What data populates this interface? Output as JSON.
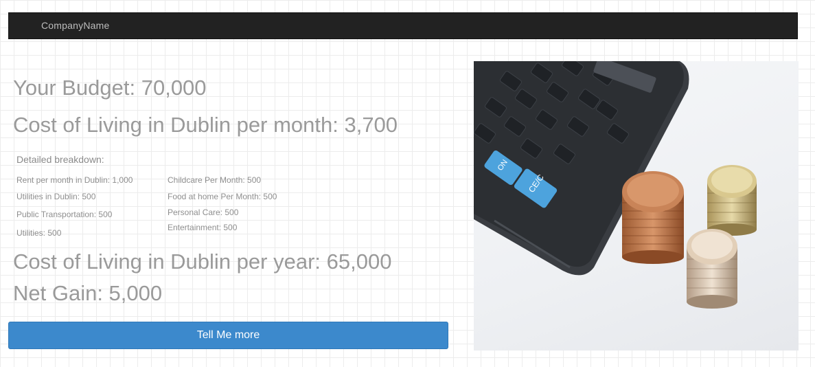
{
  "navbar": {
    "brand": "CompanyName"
  },
  "budget": {
    "your_budget": "Your Budget: 70,000",
    "cost_per_month": "Cost of Living in Dublin per month: 3,700",
    "breakdown_title": "Detailed breakdown:",
    "breakdown_left": [
      "Rent per month in Dublin: 1,000",
      "Utilities in Dublin: 500",
      "Public Transportation: 500",
      "Utilities: 500"
    ],
    "breakdown_right": [
      "Childcare Per Month: 500",
      "Food at home Per Month: 500",
      "Personal Care: 500",
      "Entertainment: 500"
    ],
    "cost_per_year": "Cost of Living in Dublin per year: 65,000",
    "net_gain": "Net Gain: 5,000"
  },
  "cta": {
    "label": "Tell Me more"
  },
  "colors": {
    "navbar": "#222222",
    "button": "#3c89cc",
    "heading": "#9a9a9a"
  },
  "image": {
    "subject": "calculator-and-coins-photo"
  }
}
